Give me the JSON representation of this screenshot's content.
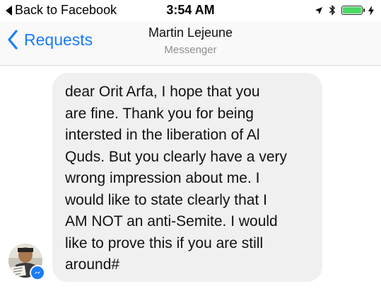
{
  "status_bar": {
    "back_to_app": "Back to Facebook",
    "time": "3:54 AM",
    "battery_level": 1.0,
    "icons": [
      "location-arrow-icon",
      "bluetooth-icon",
      "battery-icon",
      "charging-bolt-icon"
    ]
  },
  "nav": {
    "back_label": "Requests",
    "title": "Martin Lejeune",
    "subtitle": "Messenger"
  },
  "message": {
    "lines": [
      "dear Orit Arfa, I hope that you",
      "are fine. Thank you for being",
      "intersted in the liberation of Al",
      "Quds. But you clearly have a very",
      "wrong impression about me. I",
      "would like to state clearly that I",
      "AM NOT an anti-Semite. I would",
      "like to prove this if you are still",
      "around#"
    ]
  },
  "avatar": {
    "icon": "messenger-badge-icon"
  },
  "colors": {
    "accent": "#1b7cf5",
    "bubble": "#f1f0f0",
    "battery": "#4cd964"
  }
}
